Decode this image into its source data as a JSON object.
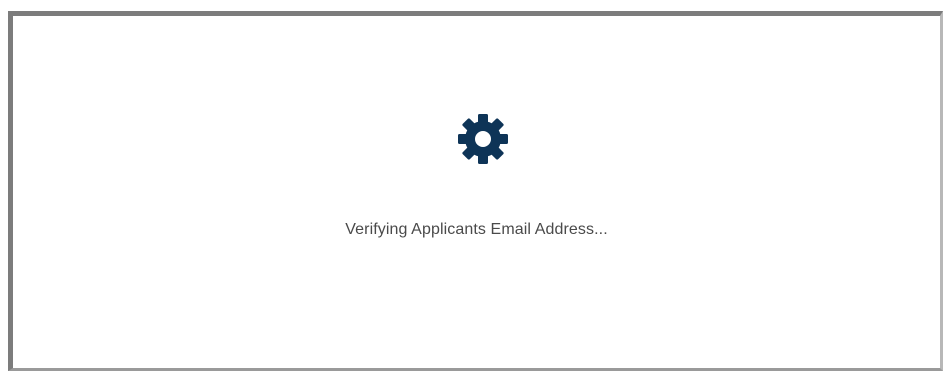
{
  "dialog": {
    "icon": "gear-icon",
    "icon_color": "#0e3457",
    "status_text": "Verifying Applicants Email Address..."
  }
}
